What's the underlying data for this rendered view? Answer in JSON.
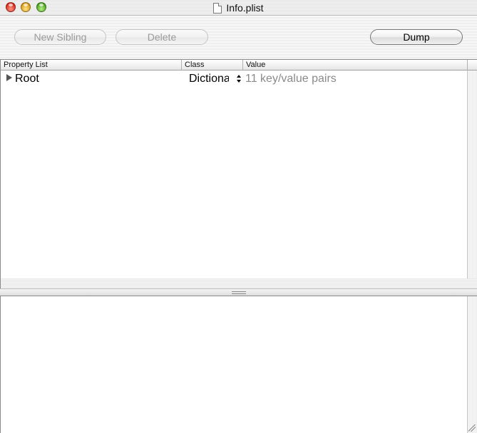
{
  "window": {
    "title": "Info.plist"
  },
  "toolbar": {
    "new_sibling_label": "New Sibling",
    "delete_label": "Delete",
    "dump_label": "Dump"
  },
  "outline": {
    "columns": [
      "Property List",
      "Class",
      "Value"
    ],
    "rows": [
      {
        "key": "Root",
        "class": "Dictionary",
        "value": "11 key/value pairs",
        "expanded": false
      }
    ]
  },
  "colors": {
    "close": "#d8281a",
    "minimize": "#d89a10",
    "zoom": "#4aa21a",
    "value_text": "#8a8a8a"
  }
}
